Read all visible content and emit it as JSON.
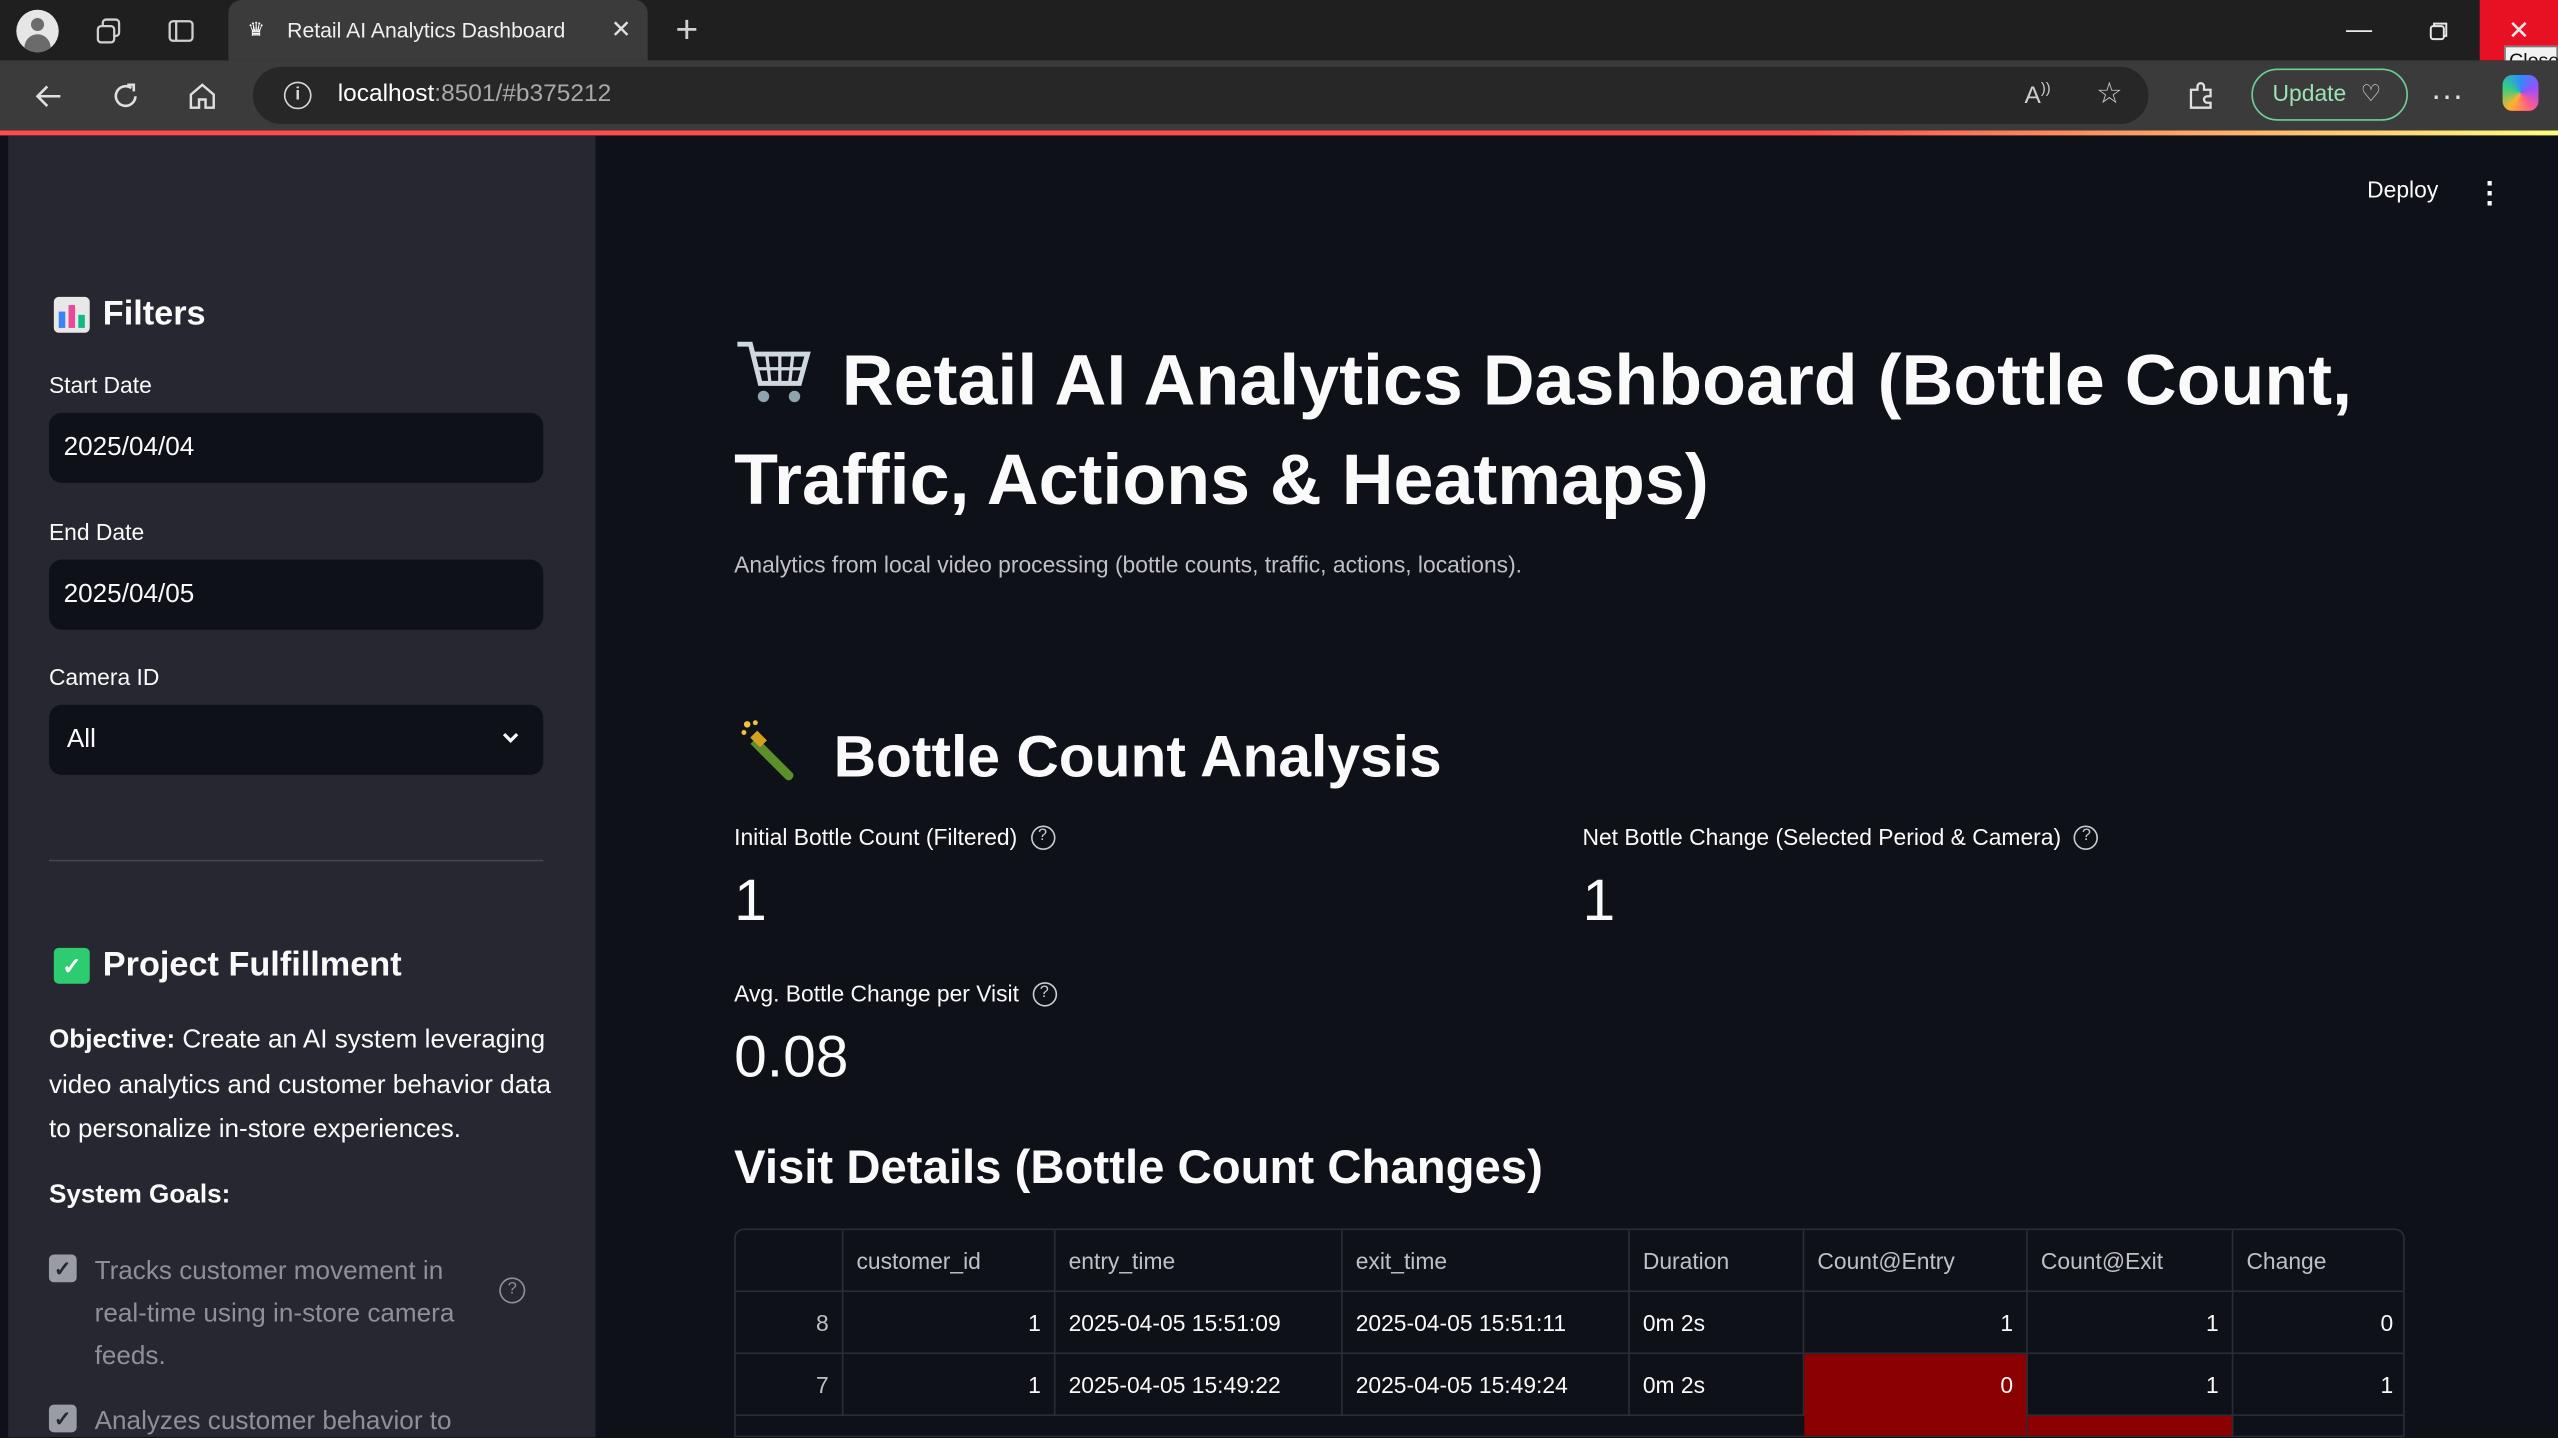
{
  "browser": {
    "tab_title": "Retail AI Analytics Dashboard",
    "url_host": "localhost",
    "url_rest": ":8501/#b375212",
    "update_label": "Update",
    "close_tooltip": "Close"
  },
  "header": {
    "deploy_label": "Deploy"
  },
  "sidebar": {
    "filters_title": "Filters",
    "start_date_label": "Start Date",
    "start_date_value": "2025/04/04",
    "end_date_label": "End Date",
    "end_date_value": "2025/04/05",
    "camera_label": "Camera ID",
    "camera_value": "All",
    "project_title": "Project Fulfillment",
    "objective_label": "Objective:",
    "objective_text": " Create an AI system leveraging video analytics and customer behavior data to personalize in-store experiences.",
    "goals_title": "System Goals:",
    "goals": [
      "Tracks customer movement in real-time using in-store camera feeds.",
      "Analyzes customer behavior to"
    ]
  },
  "main": {
    "title": "Retail AI Analytics Dashboard (Bottle Count, Traffic, Actions & Heatmaps)",
    "subtitle": "Analytics from local video processing (bottle counts, traffic, actions, locations).",
    "section_title": "Bottle Count Analysis",
    "metrics": [
      {
        "label": "Initial Bottle Count (Filtered)",
        "value": "1"
      },
      {
        "label": "Net Bottle Change (Selected Period & Camera)",
        "value": "1"
      },
      {
        "label": "Avg. Bottle Change per Visit",
        "value": "0.08"
      }
    ],
    "table_title": "Visit Details (Bottle Count Changes)",
    "table": {
      "columns": [
        "",
        "customer_id",
        "entry_time",
        "exit_time",
        "Duration",
        "Count@Entry",
        "Count@Exit",
        "Change"
      ],
      "rows": [
        [
          "8",
          "1",
          "2025-04-05 15:51:09",
          "2025-04-05 15:51:11",
          "0m 2s",
          "1",
          "1",
          "0"
        ],
        [
          "7",
          "1",
          "2025-04-05 15:49:22",
          "2025-04-05 15:49:24",
          "0m 2s",
          "0",
          "1",
          "1"
        ]
      ]
    },
    "highlight_color": "#8b0000"
  }
}
